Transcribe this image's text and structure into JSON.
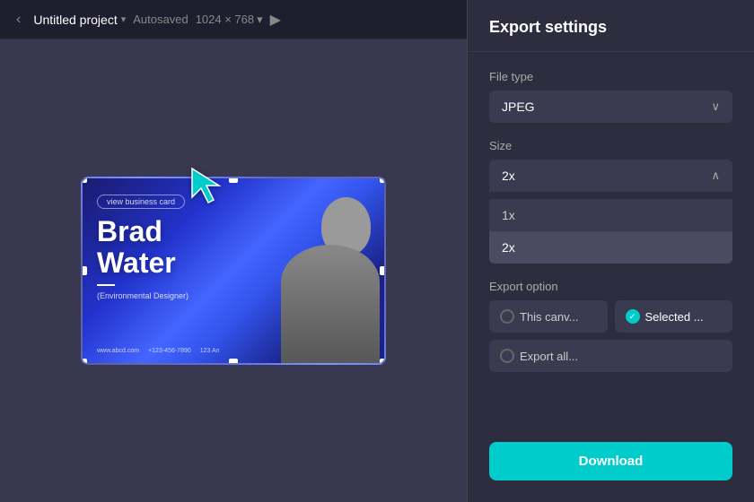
{
  "toolbar": {
    "project_name": "Untitled project",
    "autosaved": "Autosaved",
    "dimensions": "1024 × 768",
    "nav_back": "‹",
    "nav_forward": "›"
  },
  "canvas": {
    "card": {
      "tag": "view business card",
      "name_line1": "Brad",
      "name_line2": "Water",
      "title": "(Environmental Designer)",
      "website": "www.abcd.com",
      "phone": "+123-456-7890",
      "address": "123 An"
    }
  },
  "export_panel": {
    "title": "Export settings",
    "file_type_label": "File type",
    "file_type_value": "JPEG",
    "size_label": "Size",
    "size_value": "2x",
    "size_options": [
      "1x",
      "2x"
    ],
    "export_option_label": "Export option",
    "option_this_canvas": "This canv...",
    "option_selected": "Selected ...",
    "option_export_all": "Export all...",
    "download_label": "Download"
  }
}
